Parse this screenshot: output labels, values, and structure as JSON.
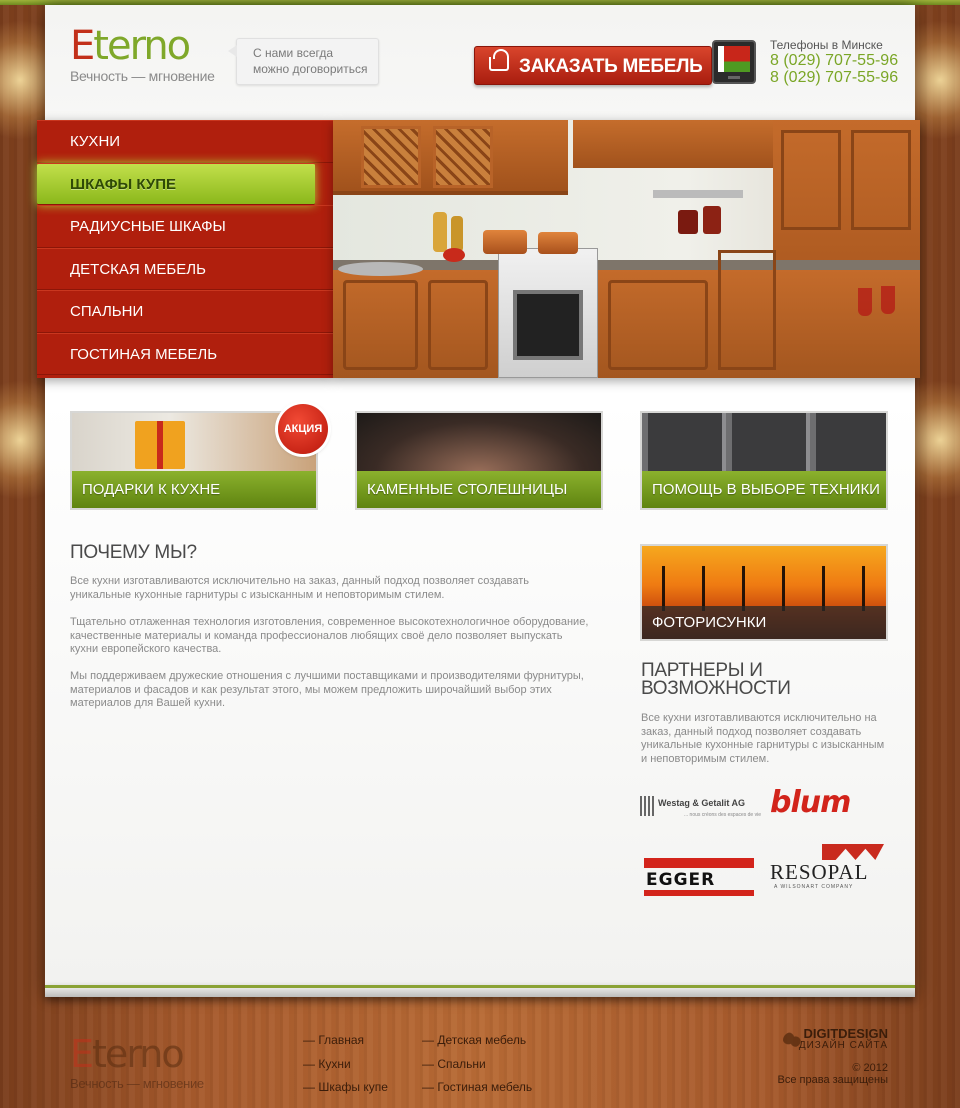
{
  "header": {
    "logo": {
      "word": "Eterno",
      "tagline": "Вечность — мгновение"
    },
    "bubble": [
      "С нами всегда",
      "можно  договориться"
    ],
    "order_button": "ЗАКАЗАТЬ МЕБЕЛЬ",
    "phones_title": "Телефоны в Минске",
    "phones": [
      "8 (029) 707-55-96",
      "8 (029) 707-55-96"
    ]
  },
  "nav": {
    "items": [
      "КУХНИ",
      "ШКАФЫ КУПЕ",
      "РАДИУСНЫЕ ШКАФЫ",
      "ДЕТСКАЯ МЕБЕЛЬ",
      "СПАЛЬНИ",
      "ГОСТИНАЯ МЕБЕЛЬ"
    ],
    "active": "ШКАФЫ КУПЕ"
  },
  "promos": {
    "gifts": "ПОДАРКИ К КУХНЕ",
    "badge": "АКЦИЯ",
    "stone": "КАМЕННЫЕ СТОЛЕШНИЦЫ",
    "tech": "ПОМОЩЬ В ВЫБОРЕ ТЕХНИКИ"
  },
  "why": {
    "title": "ПОЧЕМУ МЫ?",
    "paragraphs": [
      "Все кухни изготавливаются исключительно на заказ, данный подход позволяет создавать уникальные кухонные гарнитуры с изысканным и неповторимым стилем.",
      "Тщательно отлаженная технология изготовления, современное высокотехнологичное оборудование, качественные материалы и команда профессионалов любящих своё дело позволяет выпускать кухни европейского качества.",
      "Мы поддерживаем дружеские отношения с лучшими поставщиками и производителями фурнитуры, материалов и фасадов и как результат этого, мы можем предложить широчайший выбор этих материалов для Вашей кухни."
    ]
  },
  "sidebar": {
    "photo_label": "ФОТОРИСУНКИ",
    "partners_title": "ПАРТНЕРЫ И ВОЗМОЖНОСТИ",
    "partners_text": "Все кухни изготавливаются исключительно на заказ, данный подход позволяет создавать уникальные кухонные гарнитуры с изысканным и неповторимым стилем.",
    "partner_logos": {
      "westag": "Westag & Getalit AG",
      "westag_sub": "... nous créons des espaces de vie",
      "blum": "blum",
      "egger": "EGGER",
      "resopal": "RESOPAL",
      "resopal_sub": "A WILSONART COMPANY"
    }
  },
  "footer": {
    "logo": {
      "word": "Eterno",
      "tagline": "Вечность — мгновение"
    },
    "links_left": [
      "— Главная",
      "— Кухни",
      "— Шкафы купе"
    ],
    "links_right": [
      "— Детская мебель",
      "— Спальни",
      "— Гостиная мебель"
    ],
    "brand": "DIGITDESIGN",
    "brand_sub": "ДИЗАЙН САЙТА",
    "copyright": "© 2012",
    "rights": "Все права защищены"
  },
  "colors": {
    "accent_green": "#7fa82a",
    "accent_red": "#b01f0d",
    "wood": "#a65a2c"
  }
}
